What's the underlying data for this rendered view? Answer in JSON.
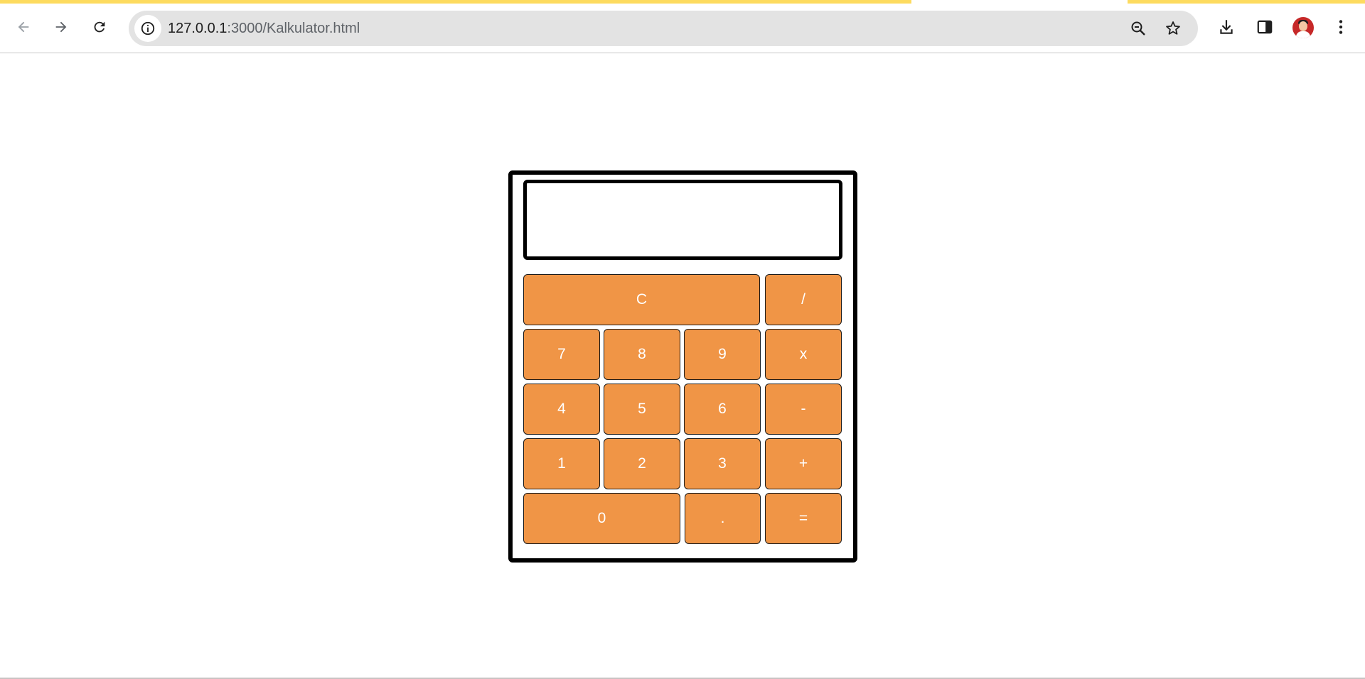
{
  "browser": {
    "url_host": "127.0.0.1",
    "url_rest": ":3000/Kalkulator.html",
    "accent_color": "#fddb5f",
    "icons": {
      "back": "arrow-left-icon",
      "forward": "arrow-right-icon",
      "reload": "reload-icon",
      "site_info": "info-icon",
      "zoom": "zoom-out-icon",
      "bookmark": "star-icon",
      "download": "download-icon",
      "side_panel": "side-panel-icon",
      "menu": "kebab-menu-icon"
    }
  },
  "calculator": {
    "display_value": "",
    "key_color": "#f09546",
    "keys": {
      "clear": "C",
      "divide": "/",
      "seven": "7",
      "eight": "8",
      "nine": "9",
      "multiply": "x",
      "four": "4",
      "five": "5",
      "six": "6",
      "minus": "-",
      "one": "1",
      "two": "2",
      "three": "3",
      "plus": "+",
      "zero": "0",
      "decimal": ".",
      "equals": "="
    }
  }
}
